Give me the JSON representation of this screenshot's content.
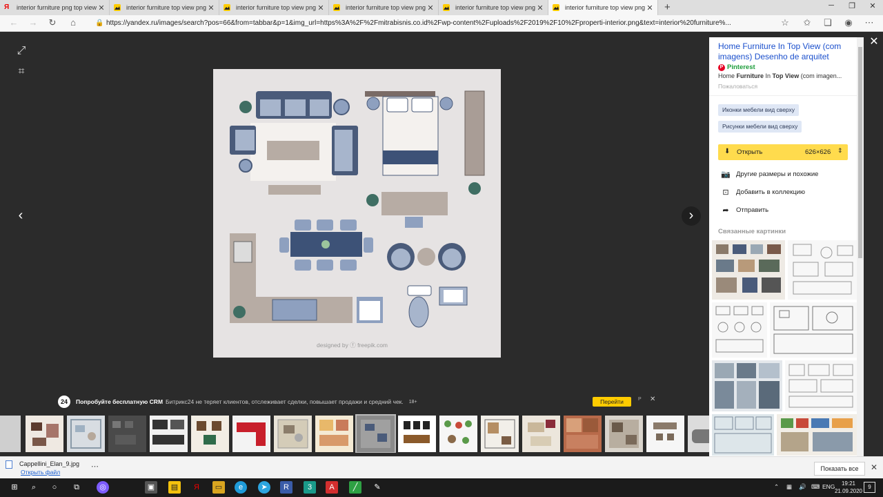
{
  "browser": {
    "tabs": [
      {
        "title": "interior furniture png top view –",
        "favicon": "yandex",
        "active": false
      },
      {
        "title": "interior furniture top view png: 1",
        "favicon": "yandex-images",
        "active": false
      },
      {
        "title": "interior furniture top view png: 1",
        "favicon": "yandex-images",
        "active": false
      },
      {
        "title": "interior furniture top view png: 1",
        "favicon": "yandex-images",
        "active": false
      },
      {
        "title": "interior furniture top view png: 1",
        "favicon": "yandex-images",
        "active": false
      },
      {
        "title": "interior furniture top view png: 1",
        "favicon": "yandex-images",
        "active": true
      }
    ],
    "close_glyph": "✕",
    "new_tab_glyph": "+",
    "window_controls": [
      "─",
      "❐",
      "✕"
    ],
    "url": "https://yandex.ru/images/search?pos=66&from=tabbar&p=1&img_url=https%3A%2F%2Fmitrabisnis.co.id%2Fwp-content%2Fuploads%2F2019%2F10%2Fproperti-interior.png&text=interior%20furniture%..."
  },
  "viewer": {
    "watermark": "designed by ⓕ freepik.com",
    "prev_glyph": "‹",
    "next_glyph": "›",
    "close_glyph": "✕"
  },
  "ad": {
    "badge": "24",
    "headline": "Попробуйте бесплатную CRM",
    "text": "Битрикс24 не теряет клиентов, отслеживает сделки, повышает продажи и средний чек.",
    "age": "18+",
    "button": "Перейти",
    "mark": "Р",
    "close": "✕"
  },
  "panel": {
    "title": "Home Furniture In Top View (com imagens) Desenho de arquitet",
    "source": "Pinterest",
    "description_parts": [
      "Home ",
      "Furniture",
      " In ",
      "Top View",
      " (com imagen..."
    ],
    "complain": "Пожаловаться",
    "tags": [
      "Иконки мебели вид сверху",
      "Рисунки мебели вид сверху"
    ],
    "open_label": "Открыть",
    "size": "626×626",
    "actions": [
      {
        "label": "Другие размеры и похожие",
        "icon": "camera-icon"
      },
      {
        "label": "Добавить в коллекцию",
        "icon": "bookmark-icon"
      },
      {
        "label": "Отправить",
        "icon": "share-icon"
      }
    ],
    "related_title": "Связанные картинки"
  },
  "downloads": {
    "file_name": "Cappellini_Elan_9.jpg",
    "open_file": "Открыть файл",
    "more": "⋯",
    "show_all": "Показать все",
    "close": "✕"
  },
  "taskbar": {
    "lang": "ENG",
    "time": "19:21",
    "date": "21.09.2020",
    "notifications": "9"
  }
}
